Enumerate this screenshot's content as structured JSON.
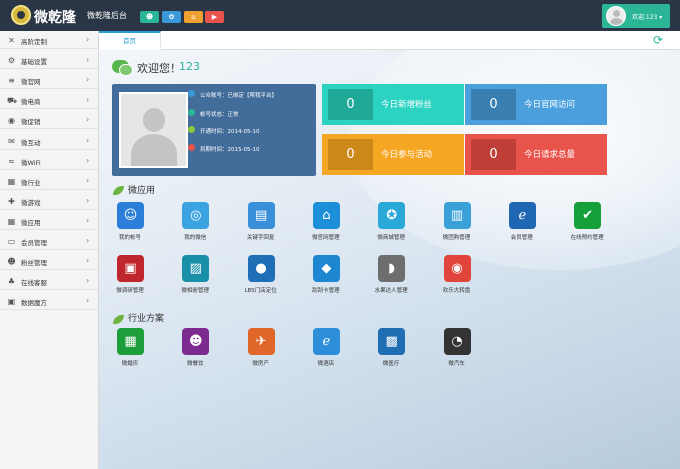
{
  "header": {
    "brand": "微乾隆",
    "subtitle": "微乾隆后台",
    "buttons": [
      {
        "icon": "users-icon",
        "glyph": "☻",
        "color": "#2ab597"
      },
      {
        "icon": "settings-icon",
        "glyph": "✿",
        "color": "#3a9ad9"
      },
      {
        "icon": "home-icon",
        "glyph": "⌂",
        "color": "#f0a030"
      },
      {
        "icon": "play-icon",
        "glyph": "▶",
        "color": "#e8534b"
      }
    ],
    "user_greeting": "欢迎,123 ▾"
  },
  "sidebar": {
    "items": [
      {
        "label": "高阶定制",
        "icon": "tools-icon",
        "glyph": "✕"
      },
      {
        "label": "基础设置",
        "icon": "gear-icon",
        "glyph": "⚙"
      },
      {
        "label": "微官网",
        "icon": "list-icon",
        "glyph": "≡"
      },
      {
        "label": "微电商",
        "icon": "cart-icon",
        "glyph": "⛟"
      },
      {
        "label": "微促销",
        "icon": "eye-icon",
        "glyph": "◉"
      },
      {
        "label": "微互动",
        "icon": "comment-icon",
        "glyph": "✉"
      },
      {
        "label": "微WiFi",
        "icon": "wifi-icon",
        "glyph": "≈"
      },
      {
        "label": "微行业",
        "icon": "building-icon",
        "glyph": "▦"
      },
      {
        "label": "微游戏",
        "icon": "gamepad-icon",
        "glyph": "✚"
      },
      {
        "label": "微应用",
        "icon": "grid-icon",
        "glyph": "▦"
      },
      {
        "label": "会员管理",
        "icon": "card-icon",
        "glyph": "▭"
      },
      {
        "label": "粉丝管理",
        "icon": "fans-icon",
        "glyph": "☻"
      },
      {
        "label": "在线客服",
        "icon": "headset-icon",
        "glyph": "♣"
      },
      {
        "label": "数据魔方",
        "icon": "cube-icon",
        "glyph": "▣"
      }
    ]
  },
  "tabs": {
    "home": "首页"
  },
  "welcome": {
    "text": "欢迎您！",
    "number": "123"
  },
  "profile": {
    "lines": [
      {
        "text": "公众账号：已绑定【帮我平台】",
        "color": "#3a9ad9"
      },
      {
        "text": "帐号状态：正常",
        "color": "#2ab597"
      },
      {
        "text": "开通时间：2014-05-10",
        "color": "#8dc63f"
      },
      {
        "text": "到期时间：2015-05-10",
        "color": "#e8534b"
      }
    ]
  },
  "stats": [
    {
      "value": "0",
      "label": "今日新增粉丝",
      "color": "#2cd3c2",
      "box": "#21a998"
    },
    {
      "value": "0",
      "label": "今日官网访问",
      "color": "#4a9fdc",
      "box": "#3a7fb2"
    },
    {
      "value": "0",
      "label": "今日参与活动",
      "color": "#f5a623",
      "box": "#cc8819"
    },
    {
      "value": "0",
      "label": "今日请求总量",
      "color": "#e8534b",
      "box": "#bf3f38"
    }
  ],
  "apps_section": {
    "title": "微应用",
    "items": [
      {
        "label": "我的帐号",
        "icon": "user-group-icon",
        "glyph": "☺",
        "color": "#2c7fd9"
      },
      {
        "label": "我的微信",
        "icon": "wechat-icon",
        "glyph": "◎",
        "color": "#3aa3e0"
      },
      {
        "label": "关键字回复",
        "icon": "reply-icon",
        "glyph": "▤",
        "color": "#3a8fd9"
      },
      {
        "label": "微官网管理",
        "icon": "house-icon",
        "glyph": "⌂",
        "color": "#1d8ed8"
      },
      {
        "label": "微商城管理",
        "icon": "film-icon",
        "glyph": "✪",
        "color": "#2aa8d8"
      },
      {
        "label": "微团购管理",
        "icon": "calc-icon",
        "glyph": "▥",
        "color": "#3aa0d8"
      },
      {
        "label": "会员管理",
        "icon": "ie-icon",
        "glyph": "ℯ",
        "color": "#1f66b3"
      },
      {
        "label": "在线预约管理",
        "icon": "check-shield-icon",
        "glyph": "✔",
        "color": "#16a03a"
      },
      {
        "label": "微调研管理",
        "icon": "newspaper-icon",
        "glyph": "▣",
        "color": "#c0272d"
      },
      {
        "label": "微相册管理",
        "icon": "image-icon",
        "glyph": "▨",
        "color": "#1a8fa8"
      },
      {
        "label": "LBS门店定位",
        "icon": "drop-icon",
        "glyph": "●",
        "color": "#1e6fb5"
      },
      {
        "label": "刮刮卡管理",
        "icon": "dropbox-icon",
        "glyph": "◆",
        "color": "#1e87d2"
      },
      {
        "label": "水果达人管理",
        "icon": "apple-icon",
        "glyph": "◗",
        "color": "#6e6e6e"
      },
      {
        "label": "欢乐大转盘",
        "icon": "chrome-icon",
        "glyph": "◉",
        "color": "#e0443a"
      }
    ]
  },
  "industry_section": {
    "title": "行业方案",
    "items": [
      {
        "label": "微婚庆",
        "icon": "bag-icon",
        "glyph": "▦",
        "color": "#1e9e3a"
      },
      {
        "label": "微餐饮",
        "icon": "smile-icon",
        "glyph": "☻",
        "color": "#7b2a8f"
      },
      {
        "label": "微房产",
        "icon": "rocket-icon",
        "glyph": "✈",
        "color": "#e0662a"
      },
      {
        "label": "微酒店",
        "icon": "ie-blue-icon",
        "glyph": "ℯ",
        "color": "#2d8fd9"
      },
      {
        "label": "微医疗",
        "icon": "gate-icon",
        "glyph": "▩",
        "color": "#1f6eb3"
      },
      {
        "label": "微汽车",
        "icon": "compass-icon",
        "glyph": "◔",
        "color": "#333333"
      }
    ]
  }
}
